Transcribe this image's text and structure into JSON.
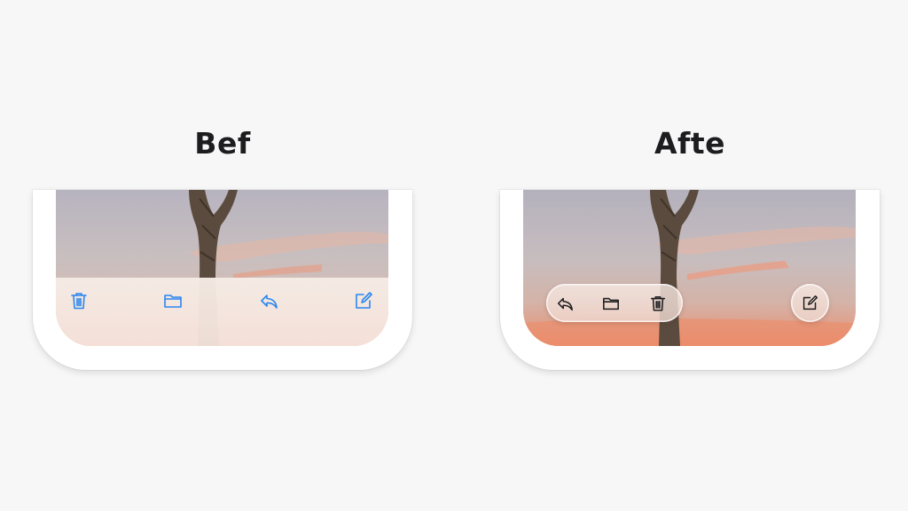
{
  "labels": {
    "before": "Bef",
    "after": "Afte"
  },
  "before": {
    "toolbar_icons": [
      "trash-icon",
      "folder-icon",
      "reply-icon",
      "compose-icon"
    ],
    "icon_color": "#2a86f0"
  },
  "after": {
    "pill_icons": [
      "reply-icon",
      "folder-icon",
      "trash-icon"
    ],
    "standalone_icon": "compose-icon",
    "icon_color": "#1d1d1f"
  }
}
